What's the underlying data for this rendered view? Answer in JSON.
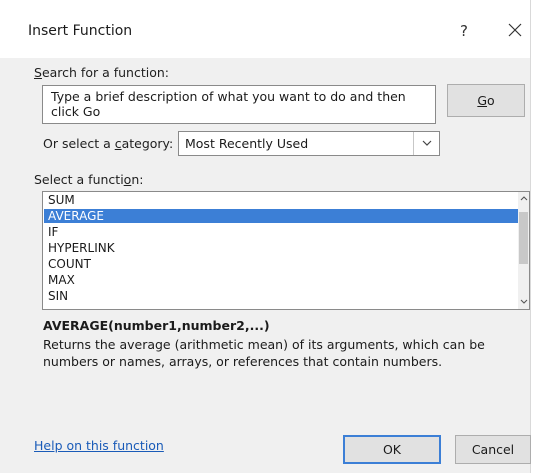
{
  "dialog": {
    "title": "Insert Function",
    "help_glyph": "?",
    "close_icon": "close-icon"
  },
  "search": {
    "label_accel": "S",
    "label_rest": "earch for a function:",
    "value": "Type a brief description of what you want to do and then click Go",
    "go_label_accel": "G",
    "go_label_rest": "o"
  },
  "category": {
    "label_pre": "Or select a ",
    "label_accel": "c",
    "label_post": "ategory:",
    "selected": "Most Recently Used",
    "dropdown_icon": "chevron-down-icon"
  },
  "functions": {
    "label_pre": "Select a functi",
    "label_accel": "o",
    "label_post": "n:",
    "items": [
      "SUM",
      "AVERAGE",
      "IF",
      "HYPERLINK",
      "COUNT",
      "MAX",
      "SIN"
    ],
    "selected": "AVERAGE",
    "scroll_up_icon": "scroll-up-icon",
    "scroll_down_icon": "scroll-down-icon"
  },
  "details": {
    "syntax": "AVERAGE(number1,number2,...)",
    "description": "Returns the average (arithmetic mean) of its arguments, which can be numbers or names, arrays, or references that contain numbers."
  },
  "footer": {
    "help_link": "Help on this function",
    "ok_label": "OK",
    "cancel_label": "Cancel"
  },
  "colors": {
    "selection": "#3c7fd6",
    "link": "#1a5bb8",
    "dialog_bg": "#f0f0f0"
  }
}
